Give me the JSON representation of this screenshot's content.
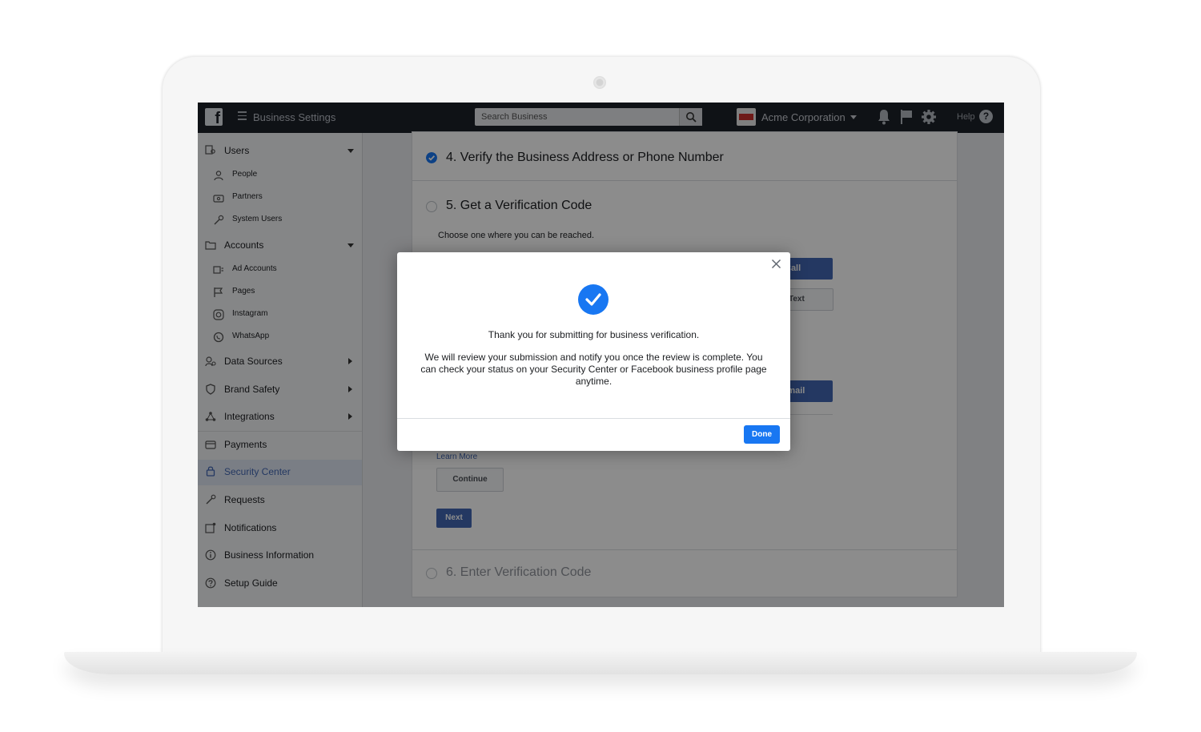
{
  "topbar": {
    "app_title": "Business Settings",
    "search_placeholder": "Search Business",
    "business_name": "Acme Corporation",
    "help_label": "Help",
    "help_icon_glyph": "?",
    "logo_glyph": "f"
  },
  "sidebar": {
    "users": "Users",
    "people": "People",
    "partners": "Partners",
    "system_users": "System Users",
    "accounts": "Accounts",
    "ad_accounts": "Ad Accounts",
    "pages": "Pages",
    "instagram": "Instagram",
    "whatsapp": "WhatsApp",
    "data_sources": "Data Sources",
    "brand_safety": "Brand Safety",
    "integrations": "Integrations",
    "payments": "Payments",
    "security_center": "Security Center",
    "requests": "Requests",
    "notifications": "Notifications",
    "business_information": "Business Information",
    "setup_guide": "Setup Guide"
  },
  "main": {
    "step4_title": "4. Verify the Business Address or Phone Number",
    "step5_title": "5. Get a Verification Code",
    "step5_instruction": "Choose one where you can be reached.",
    "call_label": "Call",
    "text_label": "Text",
    "email_label": "Email",
    "learn_more": "Learn More",
    "continue_label": "Continue",
    "next_label": "Next",
    "step6_title": "6. Enter Verification Code"
  },
  "modal": {
    "title": "Thank you for submitting for business verification.",
    "body": "We will review your submission and notify you once the review is complete. You can check your status on your Security Center or Facebook business profile page anytime.",
    "done_label": "Done"
  },
  "colors": {
    "topbar": "#1d2129",
    "accent": "#1877f2",
    "fb_blue": "#4267b2"
  }
}
